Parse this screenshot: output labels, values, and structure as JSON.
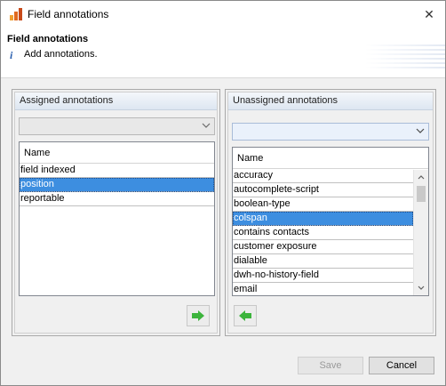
{
  "window": {
    "title": "Field annotations",
    "close_glyph": "✕"
  },
  "header": {
    "title": "Field annotations",
    "info_glyph": "i",
    "message": "Add annotations."
  },
  "assigned": {
    "panel_title": "Assigned annotations",
    "column_header": "Name",
    "items": [
      "field indexed",
      "position",
      "reportable"
    ],
    "selected_index": 1,
    "move_button_icon": "arrow-right-icon"
  },
  "unassigned": {
    "panel_title": "Unassigned annotations",
    "column_header": "Name",
    "items": [
      "accuracy",
      "autocomplete-script",
      "boolean-type",
      "colspan",
      "contains contacts",
      "customer exposure",
      "dialable",
      "dwh-no-history-field",
      "email"
    ],
    "selected_index": 3,
    "move_button_icon": "arrow-left-icon"
  },
  "footer": {
    "save_label": "Save",
    "cancel_label": "Cancel"
  },
  "colors": {
    "selection": "#3d8ee0",
    "arrow_green": "#3cb43c",
    "panel_header": "#dde6f1"
  }
}
